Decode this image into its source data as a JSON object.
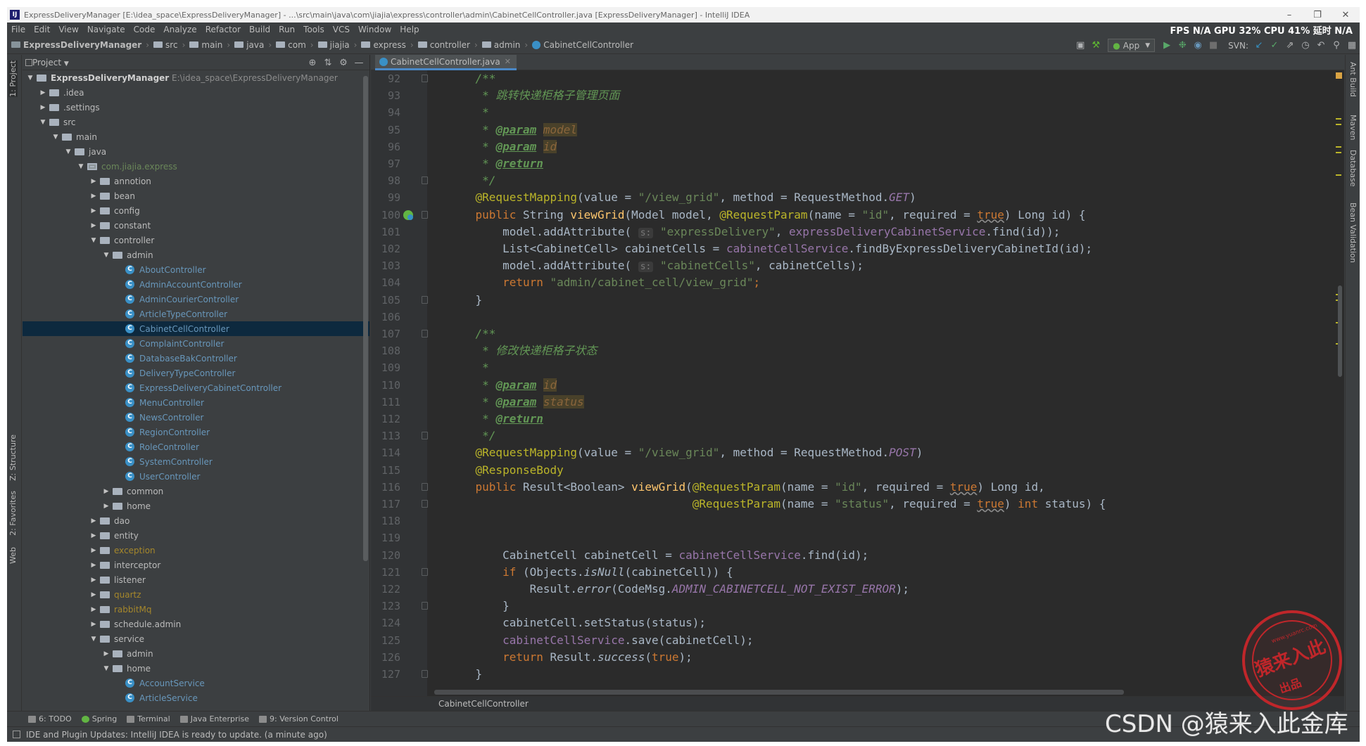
{
  "window": {
    "title": "ExpressDeliveryManager [E:\\idea_space\\ExpressDeliveryManager] - ...\\src\\main\\java\\com\\jiajia\\express\\controller\\admin\\CabinetCellController.java [ExpressDeliveryManager] - IntelliJ IDEA",
    "app_icon": "IJ"
  },
  "menu": [
    "File",
    "Edit",
    "View",
    "Navigate",
    "Code",
    "Analyze",
    "Refactor",
    "Build",
    "Run",
    "Tools",
    "VCS",
    "Window",
    "Help"
  ],
  "perf_monitor": "FPS N/A GPU 32% CPU 41% 延时 N/A",
  "breadcrumbs": [
    "ExpressDeliveryManager",
    "src",
    "main",
    "java",
    "com",
    "jiajia",
    "express",
    "controller",
    "admin",
    "CabinetCellController"
  ],
  "toolbar": {
    "run_config": "App",
    "svn_label": "SVN:"
  },
  "left_stripe": {
    "project_tab": "1: Project",
    "structure_tab": "Z: Structure",
    "favorites_tab": "2: Favorites",
    "web_tab": "Web"
  },
  "right_stripe": {
    "ant": "Ant Build",
    "maven": "Maven",
    "database": "Database",
    "bean_validation": "Bean Validation"
  },
  "project_panel": {
    "title": "Project",
    "tree": [
      {
        "depth": 0,
        "label": "ExpressDeliveryManager",
        "path": "E:\\idea_space\\ExpressDeliveryManager",
        "type": "root",
        "expanded": true
      },
      {
        "depth": 1,
        "label": ".idea",
        "type": "folder",
        "expanded": false
      },
      {
        "depth": 1,
        "label": ".settings",
        "type": "folder",
        "expanded": false
      },
      {
        "depth": 1,
        "label": "src",
        "type": "folder",
        "expanded": true
      },
      {
        "depth": 2,
        "label": "main",
        "type": "folder",
        "expanded": true
      },
      {
        "depth": 3,
        "label": "java",
        "type": "folder",
        "expanded": true
      },
      {
        "depth": 4,
        "label": "com.jiajia.express",
        "type": "package",
        "expanded": true
      },
      {
        "depth": 5,
        "label": "annotion",
        "type": "folder",
        "expanded": false
      },
      {
        "depth": 5,
        "label": "bean",
        "type": "folder",
        "expanded": false
      },
      {
        "depth": 5,
        "label": "config",
        "type": "folder",
        "expanded": false
      },
      {
        "depth": 5,
        "label": "constant",
        "type": "folder",
        "expanded": false
      },
      {
        "depth": 5,
        "label": "controller",
        "type": "folder",
        "expanded": true
      },
      {
        "depth": 6,
        "label": "admin",
        "type": "folder",
        "expanded": true
      },
      {
        "depth": 7,
        "label": "AboutController",
        "type": "class"
      },
      {
        "depth": 7,
        "label": "AdminAccountController",
        "type": "class"
      },
      {
        "depth": 7,
        "label": "AdminCourierController",
        "type": "class"
      },
      {
        "depth": 7,
        "label": "ArticleTypeController",
        "type": "class"
      },
      {
        "depth": 7,
        "label": "CabinetCellController",
        "type": "class",
        "selected": true
      },
      {
        "depth": 7,
        "label": "ComplaintController",
        "type": "class"
      },
      {
        "depth": 7,
        "label": "DatabaseBakController",
        "type": "class"
      },
      {
        "depth": 7,
        "label": "DeliveryTypeController",
        "type": "class"
      },
      {
        "depth": 7,
        "label": "ExpressDeliveryCabinetController",
        "type": "class"
      },
      {
        "depth": 7,
        "label": "MenuController",
        "type": "class"
      },
      {
        "depth": 7,
        "label": "NewsController",
        "type": "class"
      },
      {
        "depth": 7,
        "label": "RegionController",
        "type": "class"
      },
      {
        "depth": 7,
        "label": "RoleController",
        "type": "class"
      },
      {
        "depth": 7,
        "label": "SystemController",
        "type": "class"
      },
      {
        "depth": 7,
        "label": "UserController",
        "type": "class"
      },
      {
        "depth": 6,
        "label": "common",
        "type": "folder",
        "expanded": false
      },
      {
        "depth": 6,
        "label": "home",
        "type": "folder",
        "expanded": false
      },
      {
        "depth": 5,
        "label": "dao",
        "type": "folder",
        "expanded": false
      },
      {
        "depth": 5,
        "label": "entity",
        "type": "folder",
        "expanded": false
      },
      {
        "depth": 5,
        "label": "exception",
        "type": "folder",
        "expanded": false,
        "color": "yellow"
      },
      {
        "depth": 5,
        "label": "interceptor",
        "type": "folder",
        "expanded": false
      },
      {
        "depth": 5,
        "label": "listener",
        "type": "folder",
        "expanded": false
      },
      {
        "depth": 5,
        "label": "quartz",
        "type": "folder",
        "expanded": false,
        "color": "yellow"
      },
      {
        "depth": 5,
        "label": "rabbitMq",
        "type": "folder",
        "expanded": false,
        "color": "yellow"
      },
      {
        "depth": 5,
        "label": "schedule.admin",
        "type": "folder",
        "expanded": false
      },
      {
        "depth": 5,
        "label": "service",
        "type": "folder",
        "expanded": true
      },
      {
        "depth": 6,
        "label": "admin",
        "type": "folder",
        "expanded": false
      },
      {
        "depth": 6,
        "label": "home",
        "type": "folder",
        "expanded": true
      },
      {
        "depth": 7,
        "label": "AccountService",
        "type": "class"
      },
      {
        "depth": 7,
        "label": "ArticleService",
        "type": "class"
      }
    ]
  },
  "editor": {
    "tab": "CabinetCellController.java",
    "breadcrumb": "CabinetCellController",
    "lines": [
      {
        "n": "92",
        "fold": true,
        "segs": [
          [
            "doc",
            "    /**"
          ]
        ]
      },
      {
        "n": "93",
        "segs": [
          [
            "doc",
            "     * 跳转快递柜格子管理页面"
          ]
        ]
      },
      {
        "n": "94",
        "segs": [
          [
            "doc",
            "     *"
          ]
        ]
      },
      {
        "n": "95",
        "segs": [
          [
            "doc",
            "     * "
          ],
          [
            "doctag",
            "@param"
          ],
          [
            "doc",
            " "
          ],
          [
            "docparam",
            "model"
          ]
        ]
      },
      {
        "n": "96",
        "segs": [
          [
            "doc",
            "     * "
          ],
          [
            "doctag",
            "@param"
          ],
          [
            "doc",
            " "
          ],
          [
            "docparam",
            "id"
          ]
        ]
      },
      {
        "n": "97",
        "segs": [
          [
            "doc",
            "     * "
          ],
          [
            "doctag",
            "@return"
          ]
        ]
      },
      {
        "n": "98",
        "fold": true,
        "segs": [
          [
            "doc",
            "     */"
          ]
        ]
      },
      {
        "n": "99",
        "segs": [
          [
            "ann",
            "    @RequestMapping"
          ],
          [
            "plain",
            "(value = "
          ],
          [
            "str",
            "\"/view_grid\""
          ],
          [
            "plain",
            ", method = RequestMethod."
          ],
          [
            "const",
            "GET"
          ],
          [
            "plain",
            ")"
          ]
        ]
      },
      {
        "n": "100",
        "fold": true,
        "icon": true,
        "segs": [
          [
            "kw",
            "    public "
          ],
          [
            "plain",
            "String "
          ],
          [
            "fn",
            "viewGrid"
          ],
          [
            "plain",
            "(Model model, "
          ],
          [
            "ann",
            "@RequestParam"
          ],
          [
            "plain",
            "(name = "
          ],
          [
            "str",
            "\"id\""
          ],
          [
            "plain",
            ", required = "
          ],
          [
            "kwwavy",
            "true"
          ],
          [
            "plain",
            ") Long id) {"
          ]
        ]
      },
      {
        "n": "101",
        "segs": [
          [
            "plain",
            "        model.addAttribute( "
          ],
          [
            "hint",
            "s:"
          ],
          [
            "str",
            " \"expressDelivery\""
          ],
          [
            "plain",
            ", "
          ],
          [
            "fld",
            "expressDeliveryCabinetService"
          ],
          [
            "plain",
            ".find(id));"
          ]
        ]
      },
      {
        "n": "102",
        "segs": [
          [
            "plain",
            "        List<CabinetCell> cabinetCells = "
          ],
          [
            "fld",
            "cabinetCellService"
          ],
          [
            "plain",
            ".findByExpressDeliveryCabinetId(id);"
          ]
        ]
      },
      {
        "n": "103",
        "segs": [
          [
            "plain",
            "        model.addAttribute( "
          ],
          [
            "hint",
            "s:"
          ],
          [
            "str",
            " \"cabinetCells\""
          ],
          [
            "plain",
            ", cabinetCells);"
          ]
        ]
      },
      {
        "n": "104",
        "segs": [
          [
            "kw",
            "        return "
          ],
          [
            "str",
            "\"admin/cabinet_cell/view_grid\""
          ],
          [
            "kw",
            ";"
          ]
        ]
      },
      {
        "n": "105",
        "fold": true,
        "segs": [
          [
            "plain",
            "    }"
          ]
        ]
      },
      {
        "n": "106",
        "segs": []
      },
      {
        "n": "107",
        "fold": true,
        "segs": [
          [
            "doc",
            "    /**"
          ]
        ]
      },
      {
        "n": "108",
        "segs": [
          [
            "doc",
            "     * 修改快递柜格子状态"
          ]
        ]
      },
      {
        "n": "109",
        "segs": [
          [
            "doc",
            "     *"
          ]
        ]
      },
      {
        "n": "110",
        "segs": [
          [
            "doc",
            "     * "
          ],
          [
            "doctag",
            "@param"
          ],
          [
            "doc",
            " "
          ],
          [
            "docparam",
            "id"
          ]
        ]
      },
      {
        "n": "111",
        "segs": [
          [
            "doc",
            "     * "
          ],
          [
            "doctag",
            "@param"
          ],
          [
            "doc",
            " "
          ],
          [
            "docparam",
            "status"
          ]
        ]
      },
      {
        "n": "112",
        "segs": [
          [
            "doc",
            "     * "
          ],
          [
            "doctag",
            "@return"
          ]
        ]
      },
      {
        "n": "113",
        "fold": true,
        "segs": [
          [
            "doc",
            "     */"
          ]
        ]
      },
      {
        "n": "114",
        "segs": [
          [
            "ann",
            "    @RequestMapping"
          ],
          [
            "plain",
            "(value = "
          ],
          [
            "str",
            "\"/view_grid\""
          ],
          [
            "plain",
            ", method = RequestMethod."
          ],
          [
            "const",
            "POST"
          ],
          [
            "plain",
            ")"
          ]
        ]
      },
      {
        "n": "115",
        "segs": [
          [
            "ann",
            "    @ResponseBody"
          ]
        ]
      },
      {
        "n": "116",
        "fold": true,
        "segs": [
          [
            "kw",
            "    public "
          ],
          [
            "plain",
            "Result<Boolean> "
          ],
          [
            "fn",
            "viewGrid"
          ],
          [
            "plain",
            "("
          ],
          [
            "ann",
            "@RequestParam"
          ],
          [
            "plain",
            "(name = "
          ],
          [
            "str",
            "\"id\""
          ],
          [
            "plain",
            ", required = "
          ],
          [
            "kwwavy",
            "true"
          ],
          [
            "plain",
            ") Long id,"
          ]
        ]
      },
      {
        "n": "117",
        "fold": true,
        "segs": [
          [
            "plain",
            "                                    "
          ],
          [
            "ann",
            "@RequestParam"
          ],
          [
            "plain",
            "(name = "
          ],
          [
            "str",
            "\"status\""
          ],
          [
            "plain",
            ", required = "
          ],
          [
            "kwwavy",
            "true"
          ],
          [
            "plain",
            ") "
          ],
          [
            "kw",
            "int "
          ],
          [
            "plain",
            "status) {"
          ]
        ]
      },
      {
        "n": "118",
        "segs": []
      },
      {
        "n": "119",
        "segs": []
      },
      {
        "n": "120",
        "segs": [
          [
            "plain",
            "        CabinetCell cabinetCell = "
          ],
          [
            "fld",
            "cabinetCellService"
          ],
          [
            "plain",
            ".find(id);"
          ]
        ]
      },
      {
        "n": "121",
        "fold": true,
        "segs": [
          [
            "kw",
            "        if "
          ],
          [
            "plain",
            "(Objects."
          ],
          [
            "ital",
            "isNull"
          ],
          [
            "plain",
            "(cabinetCell)) {"
          ]
        ]
      },
      {
        "n": "122",
        "segs": [
          [
            "plain",
            "            Result."
          ],
          [
            "ital",
            "error"
          ],
          [
            "plain",
            "(CodeMsg."
          ],
          [
            "const",
            "ADMIN_CABINETCELL_NOT_EXIST_ERROR"
          ],
          [
            "plain",
            ");"
          ]
        ]
      },
      {
        "n": "123",
        "fold": true,
        "segs": [
          [
            "plain",
            "        }"
          ]
        ]
      },
      {
        "n": "124",
        "segs": [
          [
            "plain",
            "        cabinetCell.setStatus(status);"
          ]
        ]
      },
      {
        "n": "125",
        "segs": [
          [
            "fld",
            "        cabinetCellService"
          ],
          [
            "plain",
            ".save(cabinetCell);"
          ]
        ]
      },
      {
        "n": "126",
        "segs": [
          [
            "kw",
            "        return "
          ],
          [
            "plain",
            "Result."
          ],
          [
            "ital",
            "success"
          ],
          [
            "plain",
            "("
          ],
          [
            "kw",
            "true"
          ],
          [
            "plain",
            ");"
          ]
        ]
      },
      {
        "n": "127",
        "fold": true,
        "segs": [
          [
            "plain",
            "    }"
          ]
        ]
      }
    ]
  },
  "bottom_tools": [
    "6: TODO",
    "Spring",
    "Terminal",
    "Java Enterprise",
    "9: Version Control"
  ],
  "status": "IDE and Plugin Updates: IntelliJ IDEA is ready to update. (a minute ago)",
  "watermark": {
    "stamp_top": "www.yuanrc.com",
    "stamp_main": "猿来入此",
    "stamp_bottom": "出品",
    "csdn": "CSDN @猿来入此金库"
  },
  "colors": {
    "editor_bg": "#2b2b2b",
    "panel_bg": "#3c3f41",
    "selection": "#0d293e",
    "keyword": "#cc7832",
    "string": "#6a8759",
    "annotation": "#bbb529"
  }
}
